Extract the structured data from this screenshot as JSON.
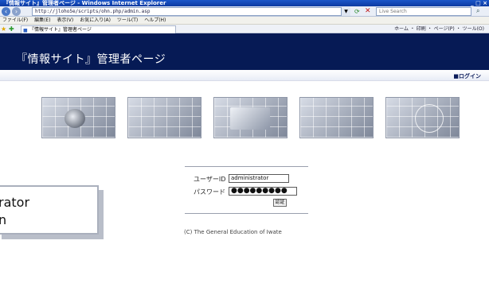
{
  "window": {
    "title": "『情報サイト』管理者ページ - Windows Internet Explorer",
    "controls": "_ □ ×"
  },
  "address_bar": {
    "url": "http://jloho5e/scripts/ohn.php/admin.asp",
    "search_placeholder": "Live Search"
  },
  "menu": {
    "items": [
      "ファイル(F)",
      "編集(E)",
      "表示(V)",
      "お気に入り(A)",
      "ツール(T)",
      "ヘルプ(H)"
    ]
  },
  "tab": {
    "label": "『情報サイト』管理者ページ",
    "tools": "ホーム ・ 印刷 ・ ページ(P) ・ ツール(O)"
  },
  "site": {
    "title": "『情報サイト』管理者ページ",
    "login_link": "■ログイン"
  },
  "form": {
    "user_label": "ユーザーID",
    "user_value": "administrator",
    "password_label": "パスワード",
    "password_value": "●●●●●●●●●",
    "submit_label": "認証"
  },
  "footer": {
    "copyright": "(C) The General Education of Iwate"
  },
  "tooltip": {
    "line1": "rator",
    "line2": "n"
  },
  "icons": {
    "back": "back-arrow-icon",
    "forward": "forward-arrow-icon",
    "refresh": "refresh-icon",
    "stop": "stop-icon",
    "search": "search-icon",
    "favorites": "star-icon"
  },
  "colors": {
    "header_bg": "#061a55",
    "titlebar": "#1b56c9"
  }
}
